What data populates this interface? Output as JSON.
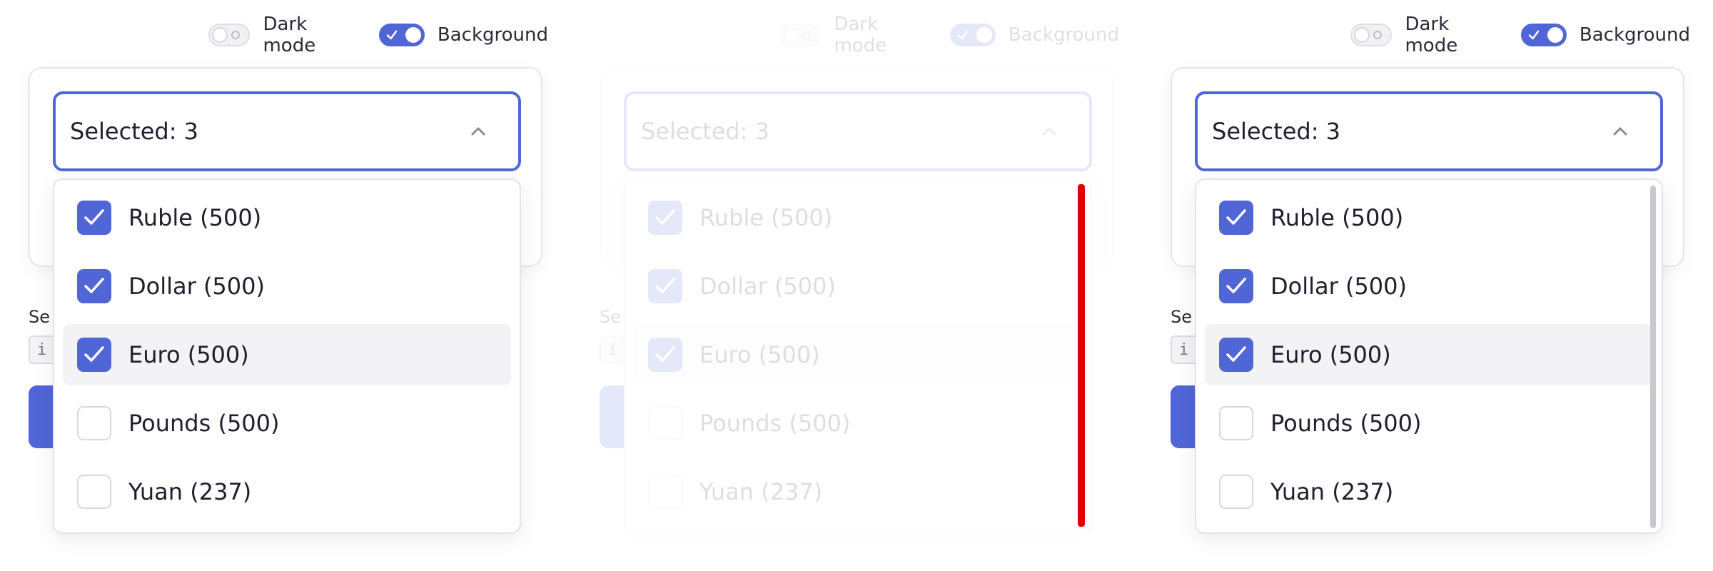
{
  "colors": {
    "accent": "#5166d6",
    "highlight_row": "#f3f3f6",
    "scroll_highlight": "#e00000"
  },
  "toggles": {
    "dark_mode_label": "Dark mode",
    "background_label": "Background"
  },
  "select": {
    "value": "Selected: 3"
  },
  "options": [
    {
      "label": "Ruble (500)",
      "checked": true
    },
    {
      "label": "Dollar (500)",
      "checked": true
    },
    {
      "label": "Euro (500)",
      "checked": true
    },
    {
      "label": "Pounds (500)",
      "checked": false
    },
    {
      "label": "Yuan (237)",
      "checked": false
    }
  ],
  "behind": {
    "label_partial": "Se",
    "code_partial": "i"
  },
  "icons": {
    "check": "check-icon",
    "chevron": "chevron-up-icon"
  }
}
